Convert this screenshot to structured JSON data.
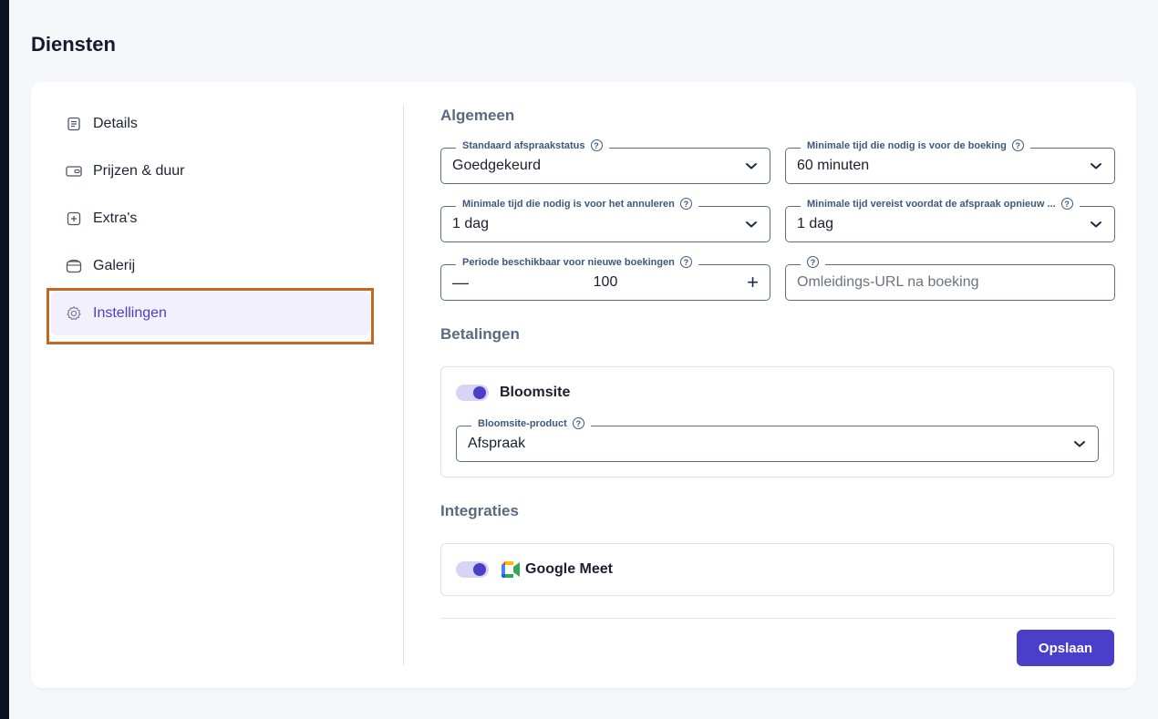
{
  "page": {
    "title": "Diensten"
  },
  "nav": {
    "items": [
      {
        "label": "Details",
        "icon": "document-icon"
      },
      {
        "label": "Prijzen & duur",
        "icon": "wallet-icon"
      },
      {
        "label": "Extra's",
        "icon": "plus-square-icon"
      },
      {
        "label": "Galerij",
        "icon": "gallery-icon"
      },
      {
        "label": "Instellingen",
        "icon": "gear-icon",
        "active": true
      }
    ]
  },
  "general": {
    "title": "Algemeen",
    "default_status": {
      "label": "Standaard afspraakstatus",
      "value": "Goedgekeurd"
    },
    "min_time_booking": {
      "label": "Minimale tijd die nodig is voor de boeking",
      "value": "60 minuten"
    },
    "min_time_cancel": {
      "label": "Minimale tijd die nodig is voor het annuleren",
      "value": "1 dag"
    },
    "min_time_reschedule": {
      "label": "Minimale tijd vereist voordat de afspraak opnieuw ...",
      "value": "1 dag"
    },
    "booking_period": {
      "label": "Periode beschikbaar voor nieuwe boekingen",
      "value": "100",
      "minus": "—",
      "plus": "+"
    },
    "redirect_url": {
      "label": "",
      "placeholder": "Omleidings-URL na boeking"
    }
  },
  "payments": {
    "title": "Betalingen",
    "bloomsite": {
      "label": "Bloomsite",
      "enabled": true
    },
    "product": {
      "label": "Bloomsite-product",
      "value": "Afspraak"
    }
  },
  "integrations": {
    "title": "Integraties",
    "google_meet": {
      "label": "Google Meet",
      "enabled": true
    }
  },
  "actions": {
    "save_label": "Opslaan"
  },
  "colors": {
    "accent": "#4a3fc9",
    "highlight": "#c7661f",
    "label": "#3d5a7a"
  }
}
